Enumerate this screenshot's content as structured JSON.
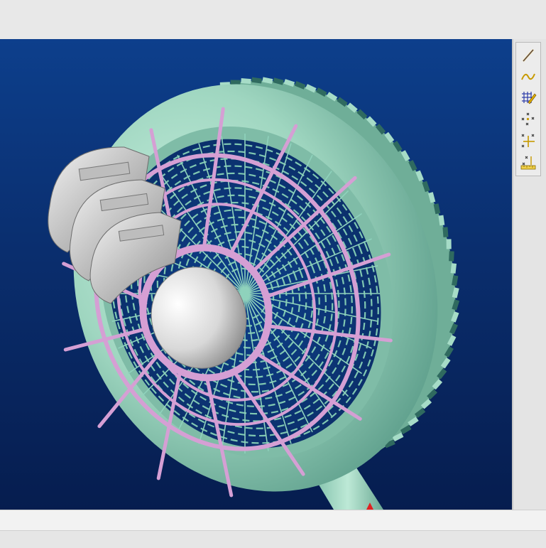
{
  "app": {
    "name": ""
  },
  "viewport": {
    "background_top": "#0d3f8c",
    "background_bottom": "#061d4f",
    "model_colors": {
      "housing": "#9fd6c0",
      "grille_ribs": "#d59fd4",
      "hub": "#e6e6e6"
    }
  },
  "toolbar": {
    "items": [
      {
        "icon": "line-icon"
      },
      {
        "icon": "curve-icon"
      },
      {
        "icon": "pattern-edit-icon"
      },
      {
        "icon": "scatter-points-icon"
      },
      {
        "icon": "axis-points-icon"
      },
      {
        "icon": "measure-icon"
      }
    ]
  }
}
